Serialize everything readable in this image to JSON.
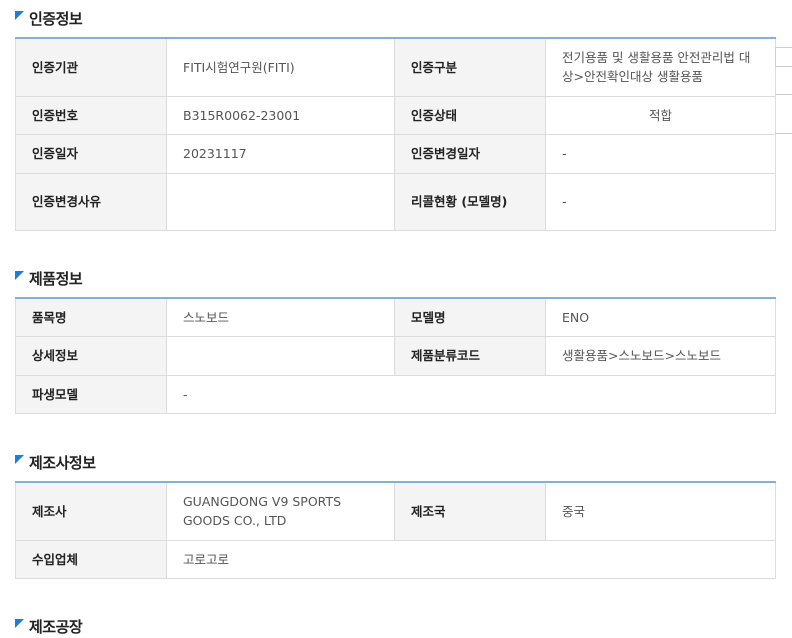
{
  "cert": {
    "title": "인증정보",
    "rows": [
      [
        {
          "h": "인증기관",
          "v": "FITI시험연구원(FITI)"
        },
        {
          "h": "인증구분",
          "v": "전기용품 및 생활용품 안전관리법 대상>안전확인대상 생활용품"
        }
      ],
      [
        {
          "h": "인증번호",
          "v": "B315R0062-23001"
        },
        {
          "h": "인증상태",
          "v": "적합"
        }
      ],
      [
        {
          "h": "인증일자",
          "v": "20231117"
        },
        {
          "h": "인증변경일자",
          "v": "-"
        }
      ],
      [
        {
          "h": "인증변경사유",
          "v": ""
        },
        {
          "h": "리콜현황 (모델명)",
          "v": "-"
        }
      ]
    ]
  },
  "product": {
    "title": "제품정보",
    "rows": [
      [
        {
          "h": "품목명",
          "v": "스노보드"
        },
        {
          "h": "모델명",
          "v": "ENO"
        }
      ],
      [
        {
          "h": "상세정보",
          "v": ""
        },
        {
          "h": "제품분류코드",
          "v": "생활용품>스노보드>스노보드"
        }
      ],
      [
        {
          "h": "파생모델",
          "v": "-"
        }
      ]
    ]
  },
  "maker": {
    "title": "제조사정보",
    "rows": [
      [
        {
          "h": "제조사",
          "v": "GUANGDONG V9 SPORTS GOODS CO., LTD"
        },
        {
          "h": "제조국",
          "v": "중국"
        }
      ],
      [
        {
          "h": "수입업체",
          "v": "고로고로"
        }
      ]
    ]
  },
  "factory": {
    "title": "제조공장"
  },
  "colors": {
    "accent": "#1a7fd8",
    "status_ok": "#1a3fa3"
  }
}
